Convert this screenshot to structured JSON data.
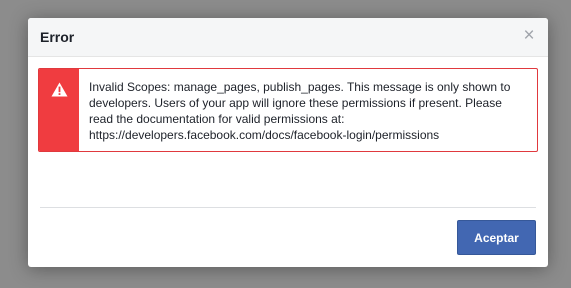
{
  "dialog": {
    "title": "Error",
    "close_icon_glyph": "×",
    "message": "Invalid Scopes: manage_pages, publish_pages. This message is only shown to\ndevelopers. Users of your app will ignore these permissions if present. Please\nread the documentation for valid permissions at:\nhttps://developers.facebook.com/docs/facebook-login/permissions",
    "accept_label": "Aceptar",
    "icon": "warning-icon",
    "colors": {
      "error_accent": "#f03c40",
      "primary_button": "#4267b2",
      "overlay": "#8c8c8c"
    }
  }
}
